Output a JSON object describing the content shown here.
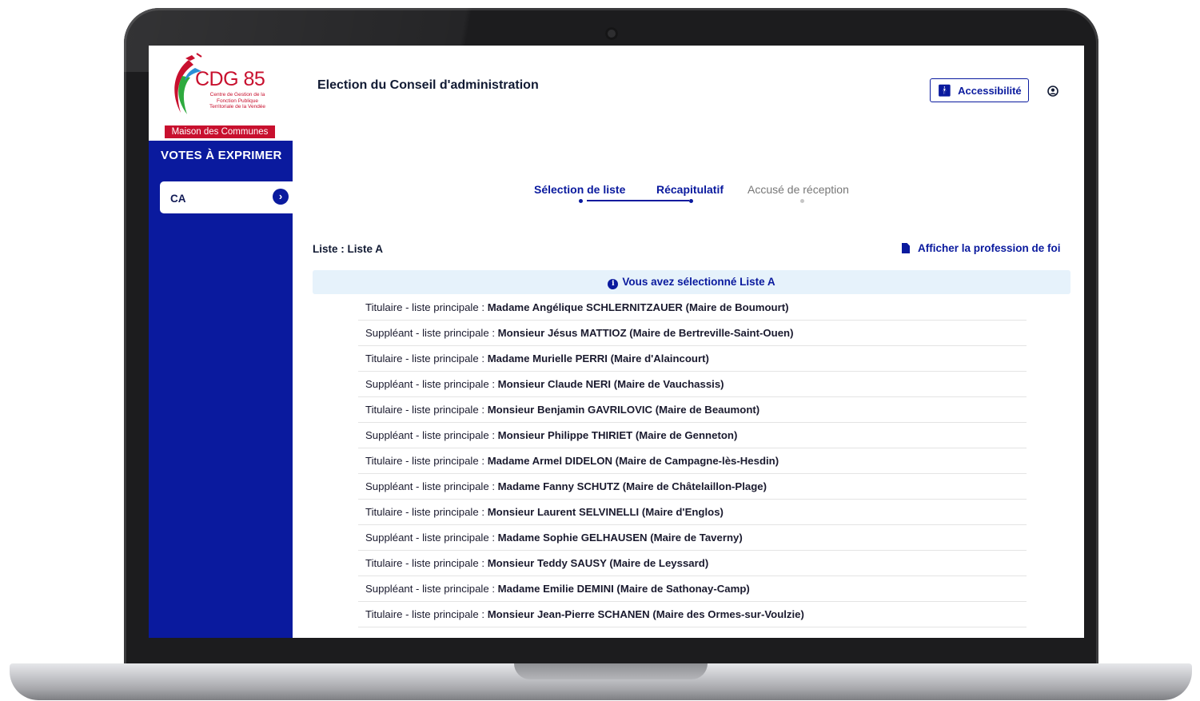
{
  "app": {
    "logo": {
      "main": "CDG 85",
      "subtitle_lines": [
        "Centre de Gestion de la",
        "Fonction Publique",
        "Territoriale de la Vendée"
      ],
      "band": "Maison des Communes"
    },
    "title": "Election du Conseil d'administration"
  },
  "sidebar": {
    "heading": "VOTES À EXPRIMER",
    "items": [
      {
        "label": "CA",
        "icon": "chevron-right-icon"
      }
    ]
  },
  "header": {
    "accessibility_label": "Accessibilité",
    "accessibility_icon": "accessibility-icon",
    "user_icon": "user-circle-icon"
  },
  "steps": [
    {
      "label": "Sélection de liste",
      "state": "done"
    },
    {
      "label": "Récapitulatif",
      "state": "current"
    },
    {
      "label": "Accusé de réception",
      "state": "todo"
    }
  ],
  "list": {
    "label": "Liste : Liste A",
    "profession_link": "Afficher la profession de foi",
    "info": "Vous avez sélectionné Liste A"
  },
  "candidates": [
    {
      "role": "Titulaire - liste principale : ",
      "name": "Madame Angélique SCHLERNITZAUER (Maire de Boumourt)"
    },
    {
      "role": "Suppléant - liste principale : ",
      "name": "Monsieur Jésus MATTIOZ (Maire de Bertreville-Saint-Ouen)"
    },
    {
      "role": "Titulaire - liste principale : ",
      "name": "Madame Murielle PERRI (Maire d'Alaincourt)"
    },
    {
      "role": "Suppléant - liste principale : ",
      "name": "Monsieur Claude NERI (Maire de Vauchassis)"
    },
    {
      "role": "Titulaire - liste principale : ",
      "name": "Monsieur Benjamin GAVRILOVIC (Maire de Beaumont)"
    },
    {
      "role": "Suppléant - liste principale : ",
      "name": "Monsieur Philippe THIRIET (Maire de Genneton)"
    },
    {
      "role": "Titulaire - liste principale : ",
      "name": "Madame Armel DIDELON (Maire de Campagne-lès-Hesdin)"
    },
    {
      "role": "Suppléant - liste principale : ",
      "name": "Madame Fanny SCHUTZ (Maire de Châtelaillon-Plage)"
    },
    {
      "role": "Titulaire - liste principale : ",
      "name": "Monsieur Laurent SELVINELLI (Maire d'Englos)"
    },
    {
      "role": "Suppléant - liste principale : ",
      "name": "Madame Sophie GELHAUSEN (Maire de Taverny)"
    },
    {
      "role": "Titulaire - liste principale : ",
      "name": "Monsieur Teddy SAUSY (Maire de Leyssard)"
    },
    {
      "role": "Suppléant - liste principale : ",
      "name": "Madame Emilie DEMINI (Maire de Sathonay-Camp)"
    },
    {
      "role": "Titulaire - liste principale : ",
      "name": "Monsieur Jean-Pierre SCHANEN (Maire des Ormes-sur-Voulzie)"
    }
  ],
  "colors": {
    "primary": "#0a1a9e",
    "logo_red": "#c8102e",
    "info_bg": "#e6f2fb"
  }
}
